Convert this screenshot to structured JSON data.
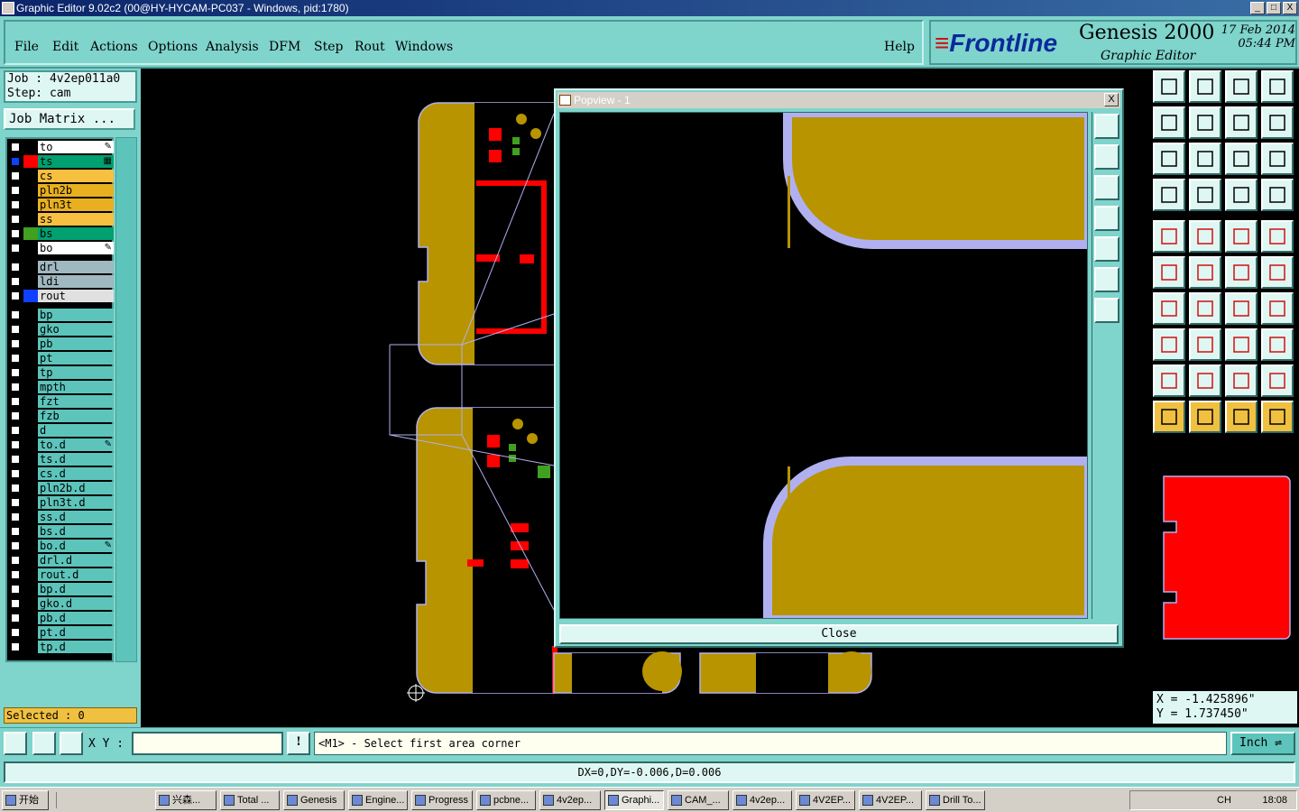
{
  "window": {
    "title": "Graphic Editor 9.02c2 (00@HY-HYCAM-PC037 - Windows, pid:1780)",
    "controls": [
      "_",
      "□",
      "X"
    ]
  },
  "menu": [
    "File",
    "Edit",
    "Actions",
    "Options",
    "Analysis",
    "DFM",
    "Step",
    "Rout",
    "Windows",
    "Help"
  ],
  "brand": {
    "logo": "Frontline",
    "product": "Genesis 2000",
    "subtitle": "Graphic Editor",
    "date": "17 Feb 2014",
    "time": "05:44 PM"
  },
  "job": {
    "job_line": "Job : 4v2ep011a0",
    "step_line": "Step: cam",
    "matrix_button": "Job Matrix ..."
  },
  "layers": [
    {
      "name": "to",
      "color": "#ffffff",
      "swatch": "",
      "mark": "✎"
    },
    {
      "name": "ts",
      "color": "#00a070",
      "swatch": "#ff0000",
      "mark": "▦",
      "active": true
    },
    {
      "name": "cs",
      "color": "#f8c040",
      "swatch": ""
    },
    {
      "name": "pln2b",
      "color": "#e8b020",
      "swatch": ""
    },
    {
      "name": "pln3t",
      "color": "#e8b020",
      "swatch": ""
    },
    {
      "name": "ss",
      "color": "#f8c040",
      "swatch": ""
    },
    {
      "name": "bs",
      "color": "#00a070",
      "swatch": "#40a020"
    },
    {
      "name": "bo",
      "color": "#ffffff",
      "swatch": "",
      "mark": "✎"
    },
    {
      "name": "drl",
      "color": "#a0b8c0",
      "swatch": "",
      "gap": true
    },
    {
      "name": "ldi",
      "color": "#a0b8c0",
      "swatch": ""
    },
    {
      "name": "rout",
      "color": "#e0e0e0",
      "swatch": "#1040ff"
    },
    {
      "name": "bp",
      "color": "#5cc4bb",
      "swatch": "",
      "gap": true
    },
    {
      "name": "gko",
      "color": "#5cc4bb",
      "swatch": ""
    },
    {
      "name": "pb",
      "color": "#5cc4bb",
      "swatch": ""
    },
    {
      "name": "pt",
      "color": "#5cc4bb",
      "swatch": ""
    },
    {
      "name": "tp",
      "color": "#5cc4bb",
      "swatch": ""
    },
    {
      "name": "mpth",
      "color": "#5cc4bb",
      "swatch": ""
    },
    {
      "name": "fzt",
      "color": "#5cc4bb",
      "swatch": ""
    },
    {
      "name": "fzb",
      "color": "#5cc4bb",
      "swatch": ""
    },
    {
      "name": "d",
      "color": "#5cc4bb",
      "swatch": ""
    },
    {
      "name": "to.d",
      "color": "#5cc4bb",
      "swatch": "",
      "mark": "✎"
    },
    {
      "name": "ts.d",
      "color": "#5cc4bb",
      "swatch": ""
    },
    {
      "name": "cs.d",
      "color": "#5cc4bb",
      "swatch": ""
    },
    {
      "name": "pln2b.d",
      "color": "#5cc4bb",
      "swatch": ""
    },
    {
      "name": "pln3t.d",
      "color": "#5cc4bb",
      "swatch": ""
    },
    {
      "name": "ss.d",
      "color": "#5cc4bb",
      "swatch": ""
    },
    {
      "name": "bs.d",
      "color": "#5cc4bb",
      "swatch": ""
    },
    {
      "name": "bo.d",
      "color": "#5cc4bb",
      "swatch": "",
      "mark": "✎"
    },
    {
      "name": "drl.d",
      "color": "#5cc4bb",
      "swatch": ""
    },
    {
      "name": "rout.d",
      "color": "#5cc4bb",
      "swatch": ""
    },
    {
      "name": "bp.d",
      "color": "#5cc4bb",
      "swatch": ""
    },
    {
      "name": "gko.d",
      "color": "#5cc4bb",
      "swatch": ""
    },
    {
      "name": "pb.d",
      "color": "#5cc4bb",
      "swatch": ""
    },
    {
      "name": "pt.d",
      "color": "#5cc4bb",
      "swatch": ""
    },
    {
      "name": "tp.d",
      "color": "#5cc4bb",
      "swatch": ""
    }
  ],
  "selected": "Selected : 0",
  "popview": {
    "title": "Popview - 1",
    "close_label": "Close",
    "close_x": "X"
  },
  "coords": {
    "x": "X = -1.425896\"",
    "y": "Y = 1.737450\""
  },
  "command": {
    "xy_label": "X Y :",
    "xy_value": "",
    "prompt": "<M1> - Select first area corner",
    "unit": "Inch",
    "info_icon": "!"
  },
  "status": "DX=0,DY=-0.006,D=0.006",
  "taskbar": {
    "start": "开始",
    "items": [
      "兴森...",
      "Total ...",
      "Genesis",
      "Engine...",
      "Progress",
      "pcbne...",
      "4v2ep...",
      "Graphi...",
      "CAM_...",
      "4v2ep...",
      "4V2EP...",
      "4V2EP...",
      "Drill To..."
    ],
    "active_index": 7,
    "tray_lang": "CH",
    "clock": "18:08"
  },
  "colors": {
    "panel": "#7fd4cc",
    "copper": "#b89400",
    "pad": "#ff0000",
    "outline": "#b0b0f0"
  }
}
